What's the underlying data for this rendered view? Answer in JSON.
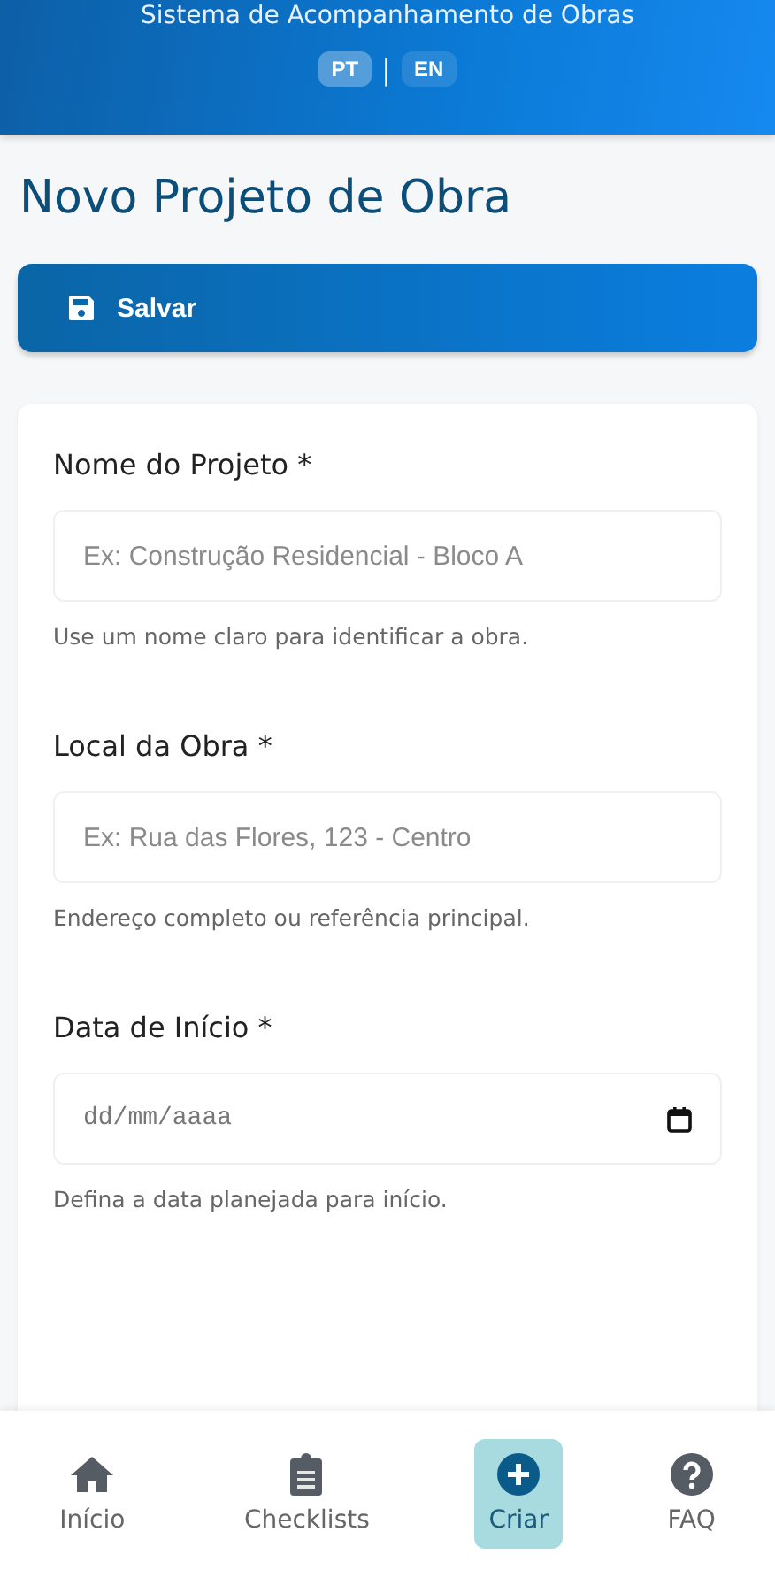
{
  "header": {
    "title": "Sistema de Acompanhamento de Obras",
    "languages": [
      {
        "label": "PT",
        "selected": true
      },
      {
        "label": "EN",
        "selected": false
      }
    ],
    "separator": "|"
  },
  "page_title": "Novo Projeto de Obra",
  "save_button": "Salvar",
  "form": {
    "fields": [
      {
        "kind": "text",
        "label": "Nome do Projeto *",
        "placeholder": "Ex: Construção Residencial - Bloco A",
        "hint": "Use um nome claro para identificar a obra."
      },
      {
        "kind": "text",
        "label": "Local da Obra *",
        "placeholder": "Ex: Rua das Flores, 123 - Centro",
        "hint": "Endereço completo ou referência principal."
      },
      {
        "kind": "date",
        "label": "Data de Início *",
        "placeholder": "dd/mm/aaaa",
        "hint": "Defina a data planejada para início."
      }
    ]
  },
  "nav": [
    {
      "kind": "home",
      "label": "Início",
      "selected": false
    },
    {
      "kind": "checklist",
      "label": "Checklists",
      "selected": false
    },
    {
      "kind": "create",
      "label": "Criar",
      "selected": true
    },
    {
      "kind": "faq",
      "label": "FAQ",
      "selected": false
    }
  ]
}
